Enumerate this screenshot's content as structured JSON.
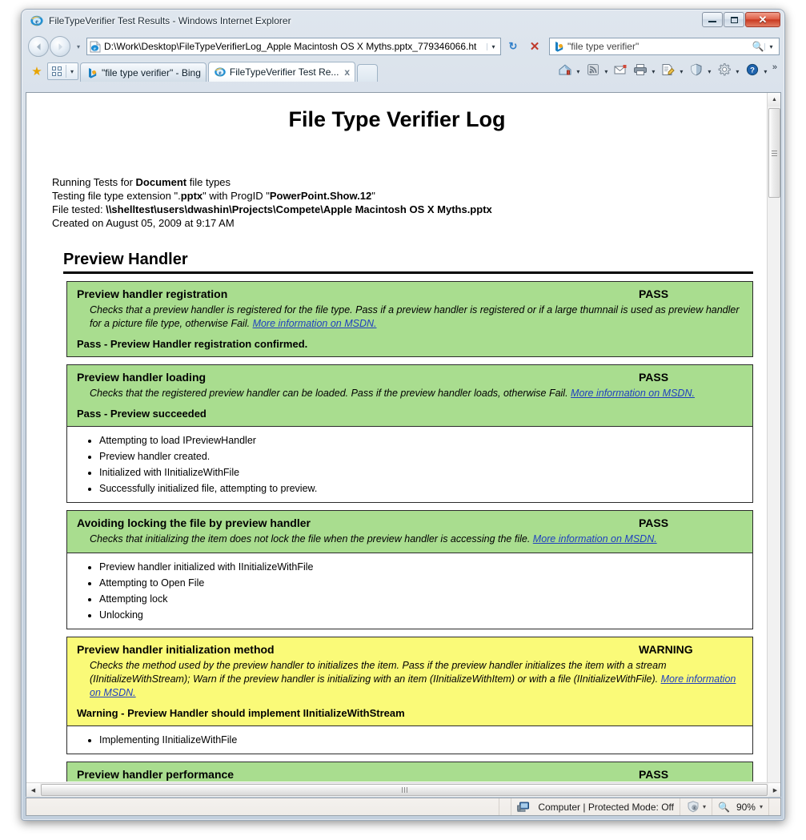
{
  "window": {
    "title": "FileTypeVerifier Test Results - Windows Internet Explorer",
    "icon": "internet-explorer-icon",
    "buttons": {
      "minimize": "Minimize",
      "maximize": "Maximize",
      "close": "Close"
    }
  },
  "toolbar": {
    "back_label": "Back",
    "forward_label": "Forward",
    "recent_pages_label": "Recent Pages",
    "address": {
      "value": "D:\\Work\\Desktop\\FileTypeVerifierLog_Apple Macintosh OS X Myths.pptx_779346066.ht",
      "placeholder": "Address"
    },
    "refresh_label": "Refresh",
    "stop_label": "Stop",
    "search": {
      "value": "\"file type verifier\"",
      "placeholder": "Search",
      "provider": "Bing"
    }
  },
  "tabbar": {
    "favorites_label": "Favorites",
    "favorites_bar_label": "Favorites Bar",
    "tabs": [
      {
        "label": "\"file type verifier\" - Bing",
        "icon": "bing-icon",
        "active": false
      },
      {
        "label": "FileTypeVerifier Test Re...",
        "icon": "internet-explorer-icon",
        "active": true,
        "close": "x"
      }
    ],
    "new_tab_label": "New Tab",
    "commands": [
      {
        "name": "home-icon",
        "glyph": "⌂"
      },
      {
        "name": "feeds-icon",
        "glyph": "◔"
      },
      {
        "name": "read-mail-icon",
        "glyph": "✉"
      },
      {
        "name": "print-icon",
        "glyph": "⎙"
      },
      {
        "name": "page-icon",
        "glyph": "☰"
      },
      {
        "name": "safety-icon",
        "glyph": "◆"
      },
      {
        "name": "tools-icon",
        "glyph": "⚙"
      },
      {
        "name": "help-icon",
        "glyph": "?"
      }
    ],
    "overflow_label": "»"
  },
  "document": {
    "title": "File Type Verifier Log",
    "meta": {
      "line1_prefix": "Running Tests for ",
      "line1_strong": "Document",
      "line1_suffix": " file types",
      "line2_prefix": "Testing file type extension \".",
      "line2_strong1": "pptx",
      "line2_mid": "\" with ProgID \"",
      "line2_strong2": "PowerPoint.Show.12",
      "line2_suffix": "\"",
      "line3_prefix": "File tested: ",
      "line3_strong": "\\\\shelltest\\users\\dwashin\\Projects\\Compete\\Apple Macintosh OS X Myths.pptx",
      "line4": "Created on August 05, 2009 at 9:17 AM"
    },
    "section_heading": "Preview Handler",
    "link_text": "More information on MSDN.",
    "tests": [
      {
        "name": "Preview handler registration",
        "status": "PASS",
        "status_kind": "pass",
        "desc_before": "Checks that a preview handler is registered for the file type. Pass if a preview handler is registered or if a large thumnail is used as preview handler for a picture file type, otherwise Fail. ",
        "desc_link": "More information on MSDN.",
        "result": "Pass - Preview Handler registration confirmed.",
        "log": []
      },
      {
        "name": "Preview handler loading",
        "status": "PASS",
        "status_kind": "pass",
        "desc_before": "Checks that the registered preview handler can be loaded. Pass if the preview handler loads, otherwise Fail. ",
        "desc_link": "More information on MSDN.",
        "result": "Pass - Preview succeeded",
        "log": [
          "Attempting to load IPreviewHandler",
          "Preview handler created.",
          "Initialized with IInitializeWithFile",
          "Successfully initialized file, attempting to preview."
        ]
      },
      {
        "name": "Avoiding locking the file by preview handler",
        "status": "PASS",
        "status_kind": "pass",
        "desc_before": "Checks that initializing the item does not lock the file when the preview handler is accessing the file. ",
        "desc_link": "More information on MSDN.",
        "result": "",
        "log": [
          "Preview handler initialized with IInitializeWithFile",
          "Attempting to Open File",
          "Attempting lock",
          "Unlocking"
        ]
      },
      {
        "name": "Preview handler initialization method",
        "status": "WARNING",
        "status_kind": "warning",
        "desc_before": "Checks the method used by the preview handler to initializes the item. Pass if the preview handler initializes the item with a stream (IInitializeWithStream); Warn if the preview handler is initializing with an item (IInitializeWithItem) or with a file (IInitializeWithFile). ",
        "desc_link": "More information on MSDN.",
        "result": "Warning - Preview Handler should implement IInitializeWithStream",
        "log": [
          "Implementing IInitializeWithFile"
        ]
      },
      {
        "name": "Preview handler performance",
        "status": "PASS",
        "status_kind": "pass",
        "desc_before": "",
        "desc_link": "",
        "result": "",
        "log": []
      }
    ]
  },
  "statusbar": {
    "message": "",
    "zone": "Computer | Protected Mode: Off",
    "zone_icon": "computer-icon",
    "protected_icon": "shield-icon",
    "zoom": "90%",
    "zoom_icon": "zoom-icon",
    "dropdown_glyph": "▾"
  },
  "colors": {
    "pass_bg": "#a9dd8f",
    "warning_bg": "#fafa78",
    "link": "#1f3fbf",
    "border": "#2b2b2b"
  }
}
